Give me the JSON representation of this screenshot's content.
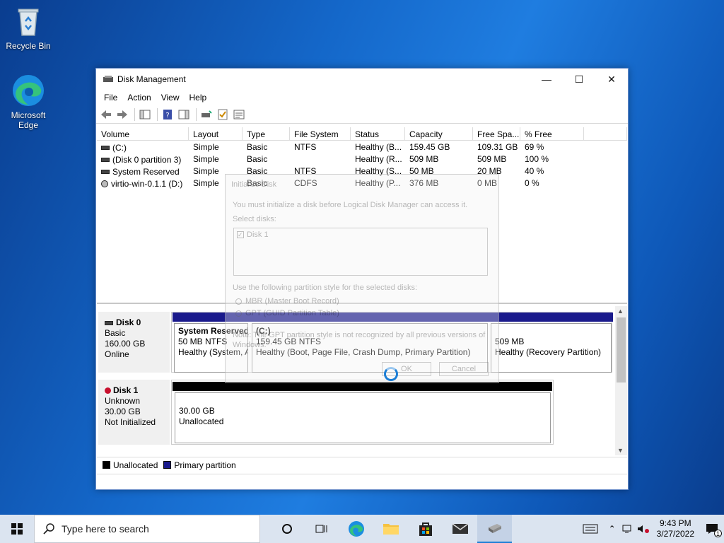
{
  "desktop": {
    "icons": [
      {
        "label": "Recycle Bin"
      },
      {
        "label": "Microsoft Edge"
      }
    ]
  },
  "window": {
    "title": "Disk Management",
    "menu": [
      "File",
      "Action",
      "View",
      "Help"
    ],
    "volume_list": {
      "columns": [
        "Volume",
        "Layout",
        "Type",
        "File System",
        "Status",
        "Capacity",
        "Free Spa...",
        "% Free"
      ],
      "rows": [
        [
          "(C:)",
          "Simple",
          "Basic",
          "NTFS",
          "Healthy (B...",
          "159.45 GB",
          "109.31 GB",
          "69 %"
        ],
        [
          "(Disk 0 partition 3)",
          "Simple",
          "Basic",
          "",
          "Healthy (R...",
          "509 MB",
          "509 MB",
          "100 %"
        ],
        [
          "System Reserved",
          "Simple",
          "Basic",
          "NTFS",
          "Healthy (S...",
          "50 MB",
          "20 MB",
          "40 %"
        ],
        [
          "virtio-win-0.1.1 (D:)",
          "Simple",
          "Basic",
          "CDFS",
          "Healthy (P...",
          "376 MB",
          "0 MB",
          "0 %"
        ]
      ]
    },
    "disks": [
      {
        "name": "Disk 0",
        "kind": "Basic",
        "size": "160.00 GB",
        "state": "Online",
        "partitions": [
          {
            "title": "System Reserved",
            "size": "50 MB NTFS",
            "status": "Healthy (System, A"
          },
          {
            "title": "(C:)",
            "size": "159.45 GB NTFS",
            "status": "Healthy (Boot, Page File, Crash Dump, Primary Partition)"
          },
          {
            "title": "",
            "size": "509 MB",
            "status": "Healthy (Recovery Partition)"
          }
        ]
      },
      {
        "name": "Disk 1",
        "kind": "Unknown",
        "size": "30.00 GB",
        "state": "Not Initialized",
        "partitions": [
          {
            "title": "",
            "size": "30.00 GB",
            "status": "Unallocated"
          }
        ]
      }
    ],
    "legend": [
      {
        "label": "Unallocated",
        "color": "#000000"
      },
      {
        "label": "Primary partition",
        "color": "#1a1a8c"
      }
    ]
  },
  "dialog": {
    "title": "Initialize Disk",
    "intro": "You must initialize a disk before Logical Disk Manager can access it.",
    "select_label": "Select disks:",
    "disk_item": "Disk 1",
    "style_label": "Use the following partition style for the selected disks:",
    "mbr": "MBR (Master Boot Record)",
    "gpt": "GPT (GUID Partition Table)",
    "note_1": "Note: The GPT partition style is not recognized by all previous versions of",
    "note_2": "Windows.",
    "ok": "OK",
    "cancel": "Cancel"
  },
  "taskbar": {
    "search_placeholder": "Type here to search",
    "time": "9:43 PM",
    "date": "3/27/2022",
    "notification_count": "1"
  },
  "colors": {
    "primary_partition": "#1a1a8c",
    "unallocated": "#000000",
    "accent": "#1e7fd6"
  }
}
